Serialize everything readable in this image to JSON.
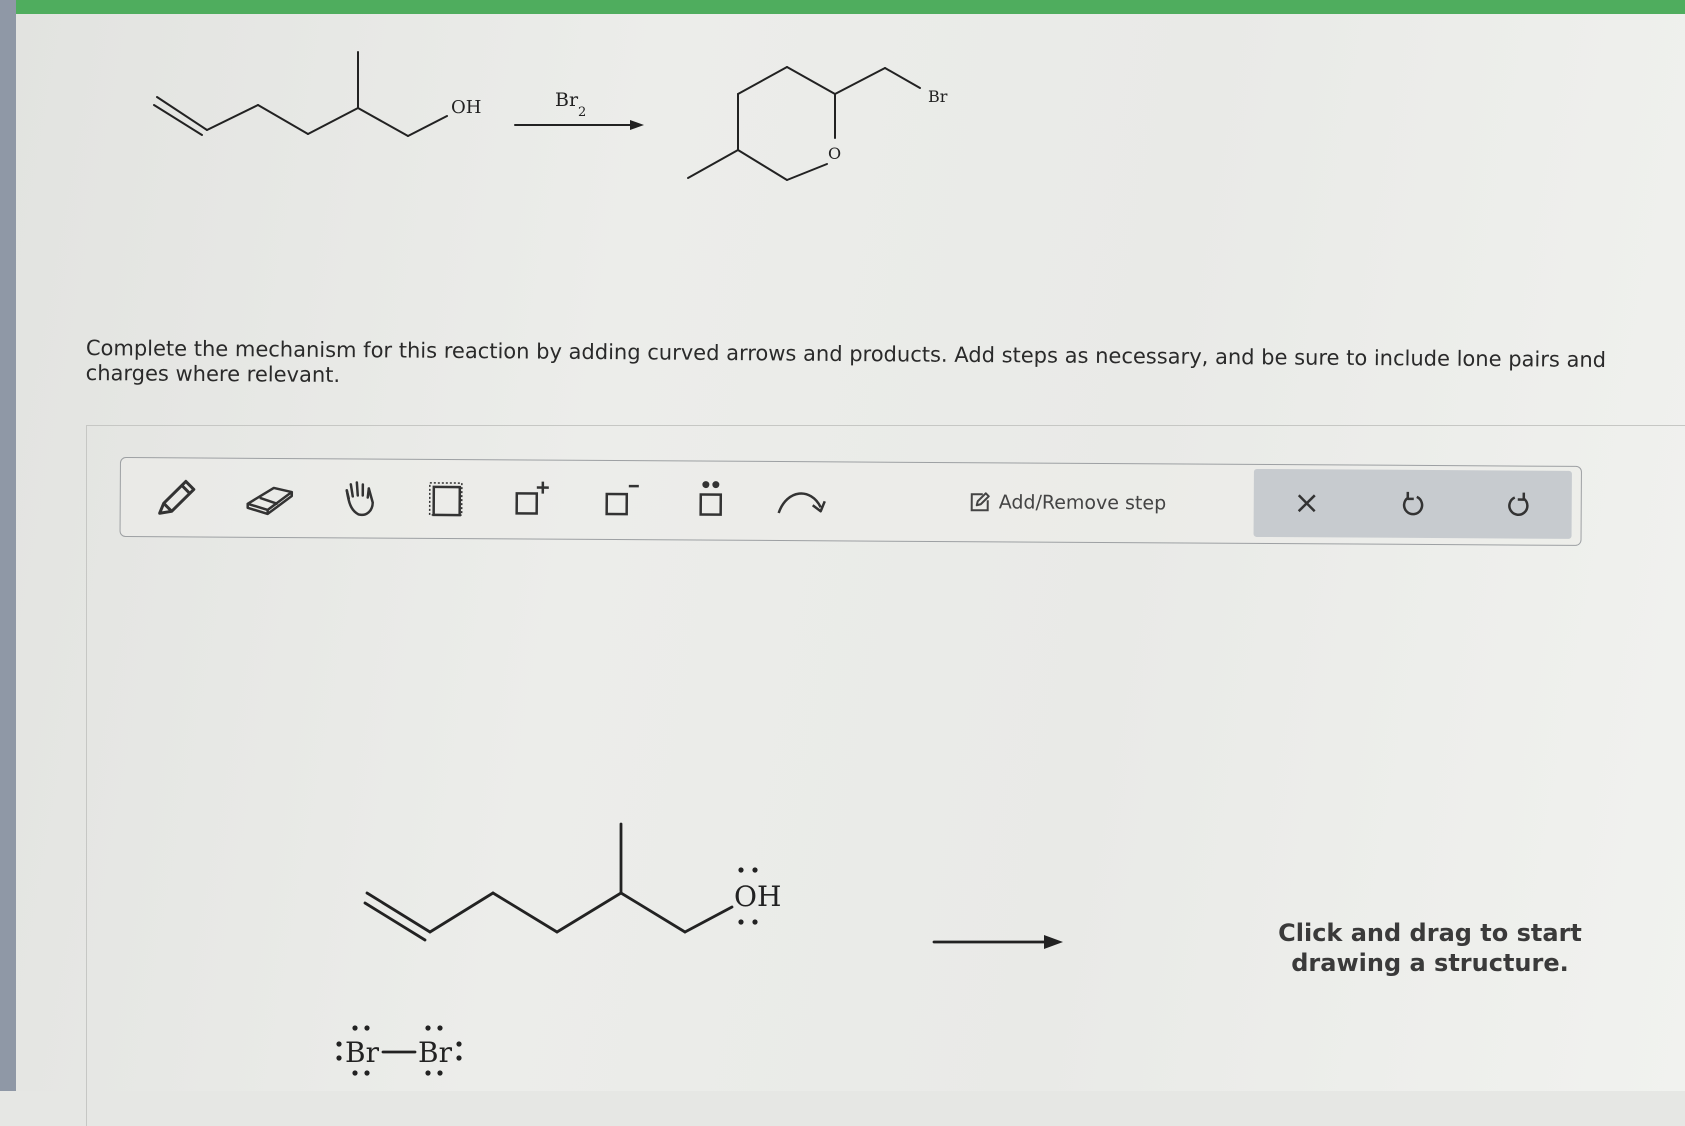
{
  "reaction": {
    "reactant_label": "OH",
    "reagent_label": "Br",
    "reagent_subscript": "2",
    "product_o_label": "O",
    "product_br_label": "Br"
  },
  "instructions": "Complete the mechanism for this reaction by adding curved arrows and products. Add steps as necessary, and be sure to include lone pairs and charges where relevant.",
  "toolbar": {
    "tools": [
      {
        "name": "pencil",
        "icon": "pencil-icon"
      },
      {
        "name": "eraser",
        "icon": "eraser-icon"
      },
      {
        "name": "hand",
        "icon": "hand-icon"
      },
      {
        "name": "select",
        "icon": "selection-box-icon"
      },
      {
        "name": "add-positive-charge",
        "icon": "positive-charge-icon"
      },
      {
        "name": "add-negative-charge",
        "icon": "negative-charge-icon"
      },
      {
        "name": "add-lone-pair",
        "icon": "lone-pair-icon"
      },
      {
        "name": "curved-arrow",
        "icon": "curved-arrow-icon"
      }
    ],
    "add_remove_label": "Add/Remove step",
    "clear_icon": "close-icon",
    "undo_icon": "undo-icon",
    "redo_icon": "redo-icon"
  },
  "canvas": {
    "oh_label": "OH",
    "br_left_label": "Br",
    "br_right_label": "Br",
    "hint_line1": "Click and drag to start",
    "hint_line2": "drawing a structure."
  },
  "colors": {
    "top_bar": "#4fad5e",
    "control_group": "#c7cbcf",
    "ink": "#222222"
  }
}
